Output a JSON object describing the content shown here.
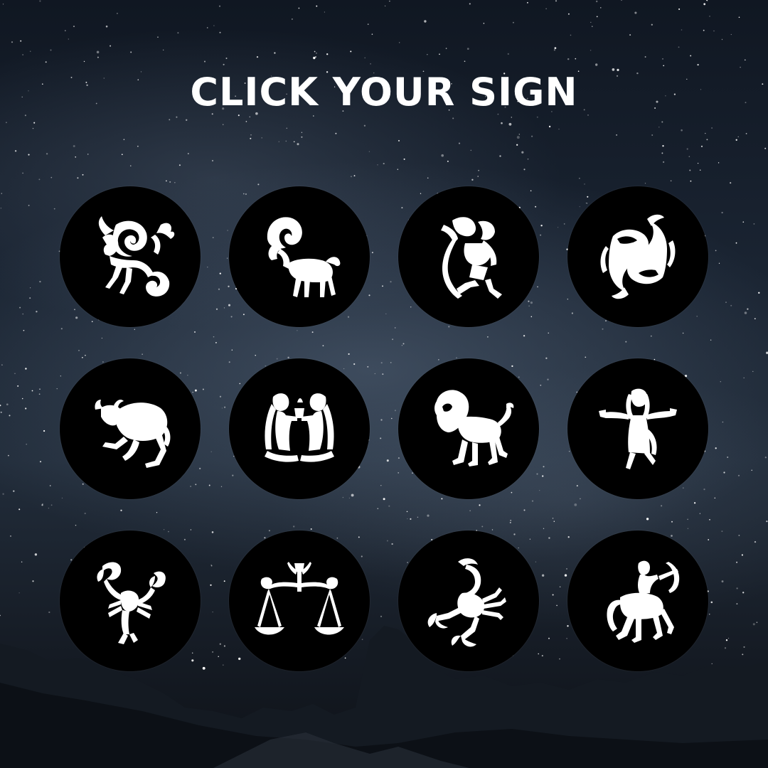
{
  "title": "CLICK YOUR SIGN",
  "colors": {
    "badge": "#000000",
    "glyph": "#ffffff",
    "title": "#ffffff",
    "sky": "#1a2432"
  },
  "signs": [
    {
      "name": "capricorn",
      "icon": "capricorn-icon"
    },
    {
      "name": "aries",
      "icon": "aries-icon"
    },
    {
      "name": "aquarius",
      "icon": "aquarius-icon"
    },
    {
      "name": "pisces",
      "icon": "pisces-icon"
    },
    {
      "name": "taurus",
      "icon": "taurus-icon"
    },
    {
      "name": "gemini",
      "icon": "gemini-icon"
    },
    {
      "name": "leo",
      "icon": "leo-icon"
    },
    {
      "name": "virgo",
      "icon": "virgo-icon"
    },
    {
      "name": "cancer",
      "icon": "cancer-icon"
    },
    {
      "name": "libra",
      "icon": "libra-icon"
    },
    {
      "name": "scorpio",
      "icon": "scorpio-icon"
    },
    {
      "name": "sagittarius",
      "icon": "sagittarius-icon"
    }
  ]
}
